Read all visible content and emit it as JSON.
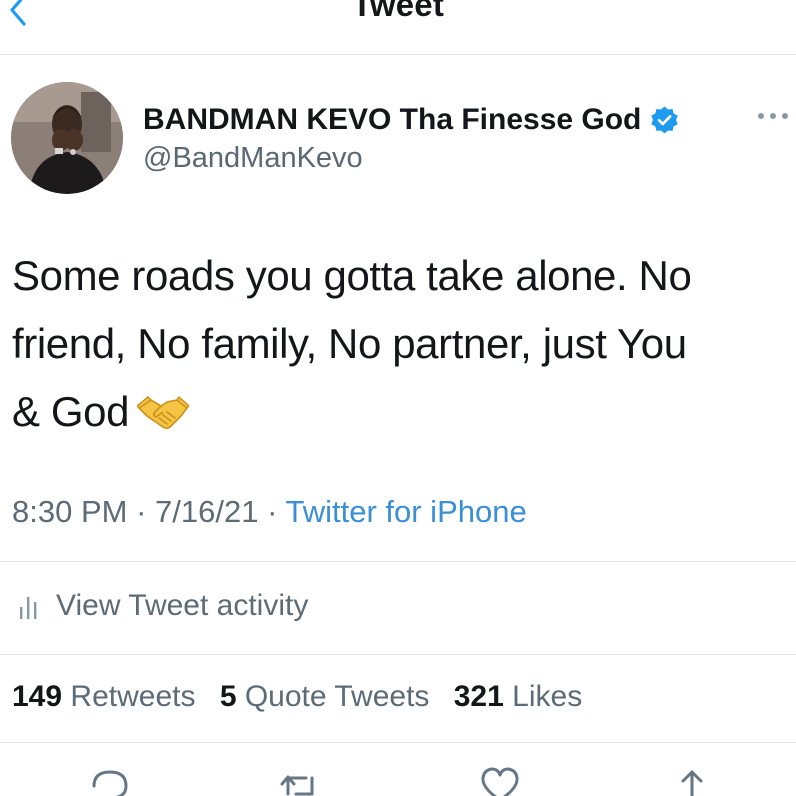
{
  "header": {
    "title": "Tweet"
  },
  "author": {
    "display_name": "BANDMAN KEVO Tha Finesse God",
    "handle": "@BandManKevo",
    "verified": true
  },
  "tweet": {
    "lines": [
      "Some roads you gotta take alone. No",
      "friend, No family, No partner, just You",
      "& God"
    ],
    "emoji": "handshake"
  },
  "meta": {
    "time": "8:30 PM",
    "separator": "·",
    "date": "7/16/21",
    "source": "Twitter for iPhone"
  },
  "activity": {
    "label": "View Tweet activity"
  },
  "stats": {
    "retweets_count": "149",
    "retweets_label": "Retweets",
    "quotes_count": "5",
    "quotes_label": "Quote Tweets",
    "likes_count": "321",
    "likes_label": "Likes"
  },
  "colors": {
    "link_blue": "#3a8fd6",
    "verified_blue": "#1d9bf0",
    "secondary_text": "#5c6b75",
    "divider": "#e1e6ea"
  }
}
